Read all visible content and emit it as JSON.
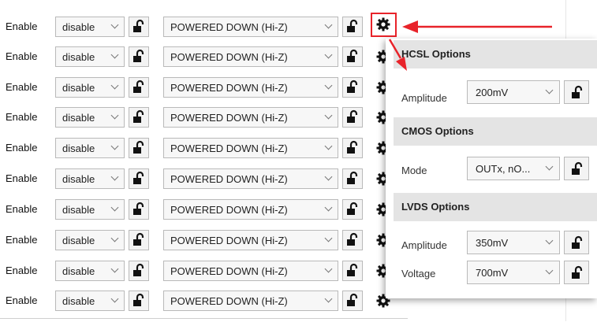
{
  "rows": [
    {
      "label": "Enable",
      "format": "disable",
      "output_mode": "POWERED DOWN (Hi-Z)"
    },
    {
      "label": "Enable",
      "format": "disable",
      "output_mode": "POWERED DOWN (Hi-Z)"
    },
    {
      "label": "Enable",
      "format": "disable",
      "output_mode": "POWERED DOWN (Hi-Z)"
    },
    {
      "label": "Enable",
      "format": "disable",
      "output_mode": "POWERED DOWN (Hi-Z)"
    },
    {
      "label": "Enable",
      "format": "disable",
      "output_mode": "POWERED DOWN (Hi-Z)"
    },
    {
      "label": "Enable",
      "format": "disable",
      "output_mode": "POWERED DOWN (Hi-Z)"
    },
    {
      "label": "Enable",
      "format": "disable",
      "output_mode": "POWERED DOWN (Hi-Z)"
    },
    {
      "label": "Enable",
      "format": "disable",
      "output_mode": "POWERED DOWN (Hi-Z)"
    },
    {
      "label": "Enable",
      "format": "disable",
      "output_mode": "POWERED DOWN (Hi-Z)"
    },
    {
      "label": "Enable",
      "format": "disable",
      "output_mode": "POWERED DOWN (Hi-Z)"
    }
  ],
  "popup": {
    "hcsl": {
      "title": "HCSL Options",
      "amplitude_label": "Amplitude",
      "amplitude_value": "200mV"
    },
    "cmos": {
      "title": "CMOS Options",
      "mode_label": "Mode",
      "mode_value": "OUTx, nO..."
    },
    "lvds": {
      "title": "LVDS Options",
      "amplitude_label": "Amplitude",
      "amplitude_value": "350mV",
      "voltage_label": "Voltage",
      "voltage_value": "700mV"
    }
  },
  "colors": {
    "annotation": "#e8232a",
    "section_bg": "#e4e4e4"
  },
  "icons": {
    "lock": "unlocked-padlock-icon",
    "gear": "gear-icon"
  }
}
